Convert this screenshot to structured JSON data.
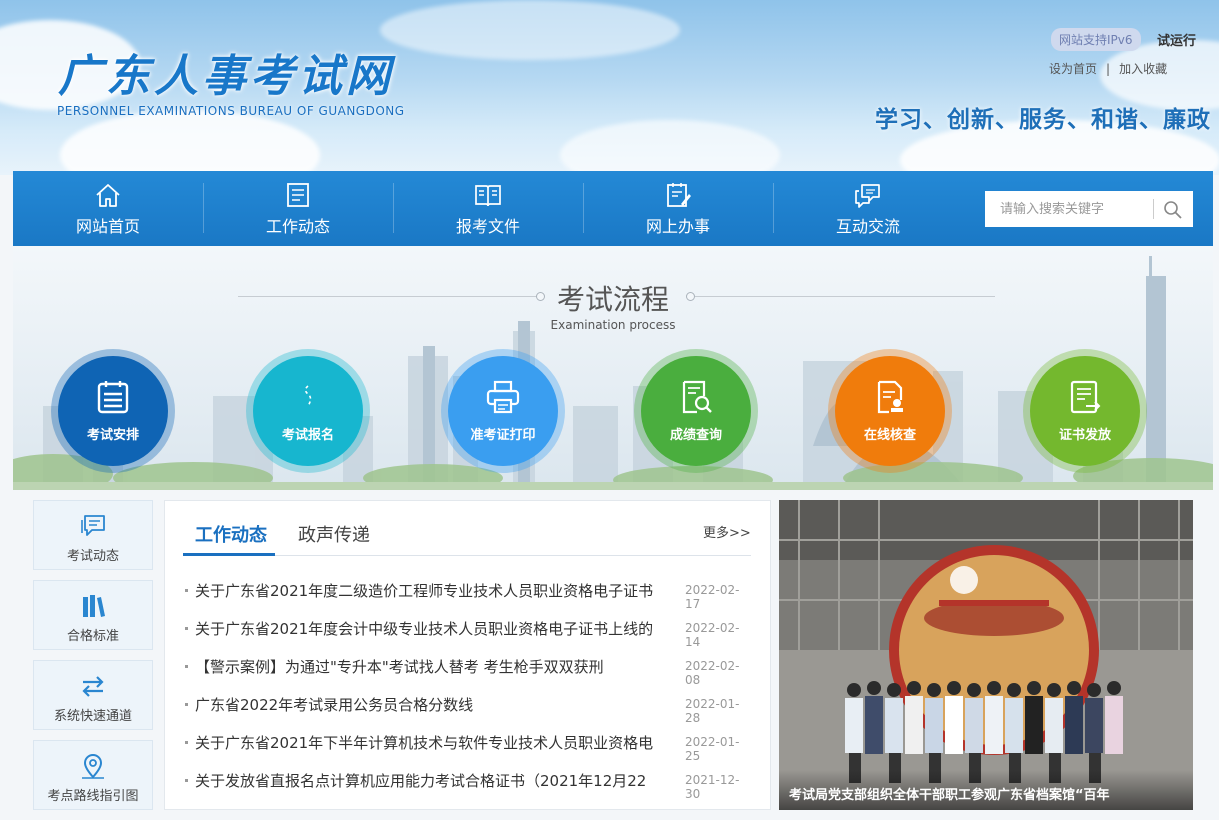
{
  "header": {
    "logo_title": "广东人事考试网",
    "logo_subtitle": "PERSONNEL EXAMINATIONS BUREAU OF GUANGDONG",
    "ipv6_badge": "网站支持IPv6",
    "trial_label": "试运行",
    "set_homepage": "设为首页",
    "separator": "|",
    "add_favorite": "加入收藏",
    "slogan": "学习、创新、服务、和谐、廉政"
  },
  "nav": {
    "items": [
      {
        "label": "网站首页",
        "icon": "home-icon"
      },
      {
        "label": "工作动态",
        "icon": "document-list-icon"
      },
      {
        "label": "报考文件",
        "icon": "book-icon"
      },
      {
        "label": "网上办事",
        "icon": "clipboard-edit-icon"
      },
      {
        "label": "互动交流",
        "icon": "chat-bubbles-icon"
      }
    ],
    "search_placeholder": "请输入搜索关键字"
  },
  "process": {
    "title": "考试流程",
    "subtitle": "Examination process",
    "steps": [
      {
        "label": "考试安排",
        "icon": "calendar-list-icon",
        "color": "#0f64b4"
      },
      {
        "label": "考试报名",
        "icon": "signup-icon",
        "color": "#17b6cf"
      },
      {
        "label": "准考证打印",
        "icon": "printer-icon",
        "color": "#3a9ef0"
      },
      {
        "label": "成绩查询",
        "icon": "search-document-icon",
        "color": "#4aae3e"
      },
      {
        "label": "在线核查",
        "icon": "verify-document-icon",
        "color": "#f07c0c"
      },
      {
        "label": "证书发放",
        "icon": "certificate-icon",
        "color": "#74b82e"
      }
    ]
  },
  "quick_links": [
    {
      "label": "考试动态",
      "icon": "chat-icon"
    },
    {
      "label": "合格标准",
      "icon": "books-icon"
    },
    {
      "label": "系统快速通道",
      "icon": "swap-arrows-icon"
    },
    {
      "label": "考点路线指引图",
      "icon": "map-pin-icon"
    }
  ],
  "news": {
    "tabs": [
      "工作动态",
      "政声传递"
    ],
    "more_label": "更多>>",
    "items": [
      {
        "title": "关于广东省2021年度二级造价工程师专业技术人员职业资格电子证书",
        "date": "2022-02-17"
      },
      {
        "title": "关于广东省2021年度会计中级专业技术人员职业资格电子证书上线的",
        "date": "2022-02-14"
      },
      {
        "title": "【警示案例】为通过\"专升本\"考试找人替考 考生枪手双双获刑",
        "date": "2022-02-08"
      },
      {
        "title": "广东省2022年考试录用公务员合格分数线",
        "date": "2022-01-28"
      },
      {
        "title": "关于广东省2021年下半年计算机技术与软件专业技术人员职业资格电",
        "date": "2022-01-25"
      },
      {
        "title": "关于发放省直报名点计算机应用能力考试合格证书（2021年12月22",
        "date": "2021-12-30"
      }
    ]
  },
  "photo": {
    "caption": "考试局党支部组织全体干部职工参观广东省档案馆“百年"
  },
  "colors": {
    "nav_blue": "#1a78c5",
    "accent_blue": "#1a70c0"
  }
}
